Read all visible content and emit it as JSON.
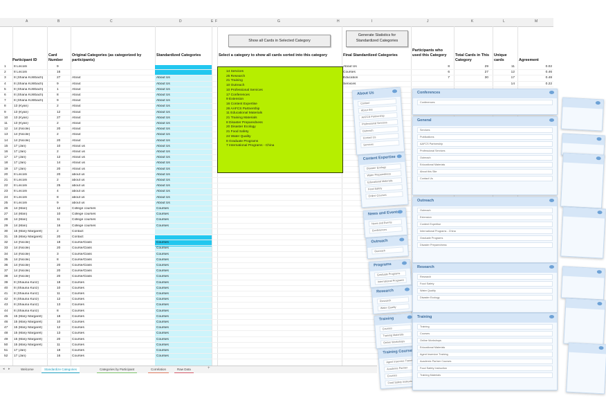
{
  "columns": [
    "A",
    "B",
    "C",
    "D",
    "E",
    "F",
    "G",
    "H",
    "I",
    "J",
    "K",
    "L",
    "M"
  ],
  "headers": {
    "participant": "Participant ID",
    "card_number": "Card Number",
    "original": "Original Categories (as categorized by participants)",
    "standardized": "Standardized Categories",
    "select_prompt": "Select a category to show all cards sorted into this category",
    "final": "Final Standardized Categories",
    "participants_used": "Participants who used this Category",
    "total_cards": "Total Cards in This Category",
    "unique_cards": "Unique cards",
    "agreement": "Agreement"
  },
  "buttons": {
    "show_all": "Show all Cards in Selected Category",
    "generate": "Generate Statistics for Standardized Categories"
  },
  "rows": [
    [
      "1",
      "8 Lincoln",
      "9",
      "",
      ""
    ],
    [
      "2",
      "8 Lincoln",
      "16",
      "",
      ""
    ],
    [
      "3",
      "8 (Shana Kohlbach)",
      "27",
      "About",
      "About Us"
    ],
    [
      "4",
      "8 (Shana Kohlbach)",
      "9",
      "About",
      "About Us"
    ],
    [
      "5",
      "8 (Shana Kohlbach)",
      "1",
      "About",
      "About Us"
    ],
    [
      "6",
      "8 (Shana Kohlbach)",
      "8",
      "About",
      "About Us"
    ],
    [
      "7",
      "8 (Shana Kohlbach)",
      "9",
      "About",
      "About Us"
    ],
    [
      "8",
      "13 (Kyan)",
      "2",
      "About",
      "About Us"
    ],
    [
      "9",
      "13 (Kyan)",
      "12",
      "About",
      "About Us"
    ],
    [
      "10",
      "13 (Kyan)",
      "27",
      "About",
      "About Us"
    ],
    [
      "11",
      "13 (Kyan)",
      "2",
      "About",
      "About Us"
    ],
    [
      "12",
      "14 (Nicole)",
      "20",
      "About",
      "About Us"
    ],
    [
      "13",
      "14 (Nicole)",
      "2",
      "About",
      "About Us"
    ],
    [
      "14",
      "14 (Nicole)",
      "20",
      "About",
      "About Us"
    ],
    [
      "15",
      "17 (Jan)",
      "10",
      "About us",
      "About Us"
    ],
    [
      "16",
      "17 (Jan)",
      "2",
      "About us",
      "About Us"
    ],
    [
      "17",
      "17 (Jan)",
      "12",
      "About us",
      "About Us"
    ],
    [
      "18",
      "17 (Jan)",
      "14",
      "About us",
      "About Us"
    ],
    [
      "19",
      "17 (Jan)",
      "20",
      "About us",
      "About Us"
    ],
    [
      "20",
      "8 Lincoln",
      "20",
      "about us",
      "About Us"
    ],
    [
      "21",
      "8 Lincoln",
      "2",
      "about us",
      "About Us"
    ],
    [
      "22",
      "8 Lincoln",
      "25",
      "about us",
      "About Us"
    ],
    [
      "23",
      "8 Lincoln",
      "4",
      "about us",
      "About Us"
    ],
    [
      "24",
      "8 Lincoln",
      "8",
      "about us",
      "About Us"
    ],
    [
      "25",
      "8 Lincoln",
      "9",
      "about us",
      "About Us"
    ],
    [
      "26",
      "14 (Mari)",
      "12",
      "College courses",
      "Courses"
    ],
    [
      "27",
      "14 (Mari)",
      "10",
      "College courses",
      "Courses"
    ],
    [
      "28",
      "14 (Mari)",
      "11",
      "College courses",
      "Courses"
    ],
    [
      "29",
      "14 (Mari)",
      "16",
      "College courses",
      "Courses"
    ],
    [
      "30",
      "15 (Mary Margaret)",
      "2",
      "Contact",
      ""
    ],
    [
      "31",
      "15 (Mary Margaret)",
      "20",
      "Contact",
      ""
    ],
    [
      "32",
      "14 (Nicole)",
      "18",
      "Course/Class",
      "Courses"
    ],
    [
      "33",
      "14 (Nicole)",
      "20",
      "Course/Class",
      "Courses"
    ],
    [
      "34",
      "14 (Nicole)",
      "3",
      "Course/Class",
      "Courses"
    ],
    [
      "35",
      "14 (Nicole)",
      "8",
      "Course/Class",
      "Courses"
    ],
    [
      "36",
      "14 (Nicole)",
      "20",
      "Course/Class",
      "Courses"
    ],
    [
      "37",
      "14 (Nicole)",
      "20",
      "Course/Class",
      "Courses"
    ],
    [
      "38",
      "14 (Nicole)",
      "20",
      "Course/Class",
      "Courses"
    ],
    [
      "39",
      "8 (Shauna Kunz)",
      "18",
      "Courses",
      "Courses"
    ],
    [
      "40",
      "8 (Shauna Kunz)",
      "10",
      "Courses",
      "Courses"
    ],
    [
      "41",
      "8 (Shauna Kunz)",
      "11",
      "Courses",
      "Courses"
    ],
    [
      "42",
      "8 (Shauna Kunz)",
      "12",
      "Courses",
      "Courses"
    ],
    [
      "43",
      "8 (Shauna Kunz)",
      "13",
      "Courses",
      "Courses"
    ],
    [
      "44",
      "8 (Shauna Kunz)",
      "8",
      "Courses",
      "Courses"
    ],
    [
      "45",
      "15 (Mary Margaret)",
      "18",
      "Courses",
      "Courses"
    ],
    [
      "46",
      "15 (Mary Margaret)",
      "10",
      "Courses",
      "Courses"
    ],
    [
      "47",
      "15 (Mary Margaret)",
      "12",
      "Courses",
      "Courses"
    ],
    [
      "48",
      "15 (Mary Margaret)",
      "13",
      "Courses",
      "Courses"
    ],
    [
      "49",
      "15 (Mary Margaret)",
      "20",
      "Courses",
      "Courses"
    ],
    [
      "50",
      "15 (Mary Margaret)",
      "11",
      "Courses",
      "Courses"
    ],
    [
      "51",
      "17 (Jan)",
      "18",
      "Courses",
      "Courses"
    ],
    [
      "52",
      "17 (Jan)",
      "16",
      "Courses",
      "Courses"
    ]
  ],
  "green_list": [
    "14 Services",
    "25 Research",
    "21 Training",
    "10 Outreach",
    "10 Professional Services",
    "17 Conferences",
    "9 Extension",
    "16 Content Expertise",
    "26 AAFCS Partnership",
    "11 Educational Materials",
    "21 Training Materials",
    "8 Disaster Preparedness",
    "20 Disaster Ecology",
    "21 Food Safety",
    "24 Water Quality",
    "8 Graduate Programs",
    "7 International Programs - China"
  ],
  "stats": [
    [
      "About Us",
      "8",
      "29",
      "11",
      "0.02"
    ],
    [
      "Courses",
      "6",
      "27",
      "12",
      "0.46"
    ],
    [
      "Education",
      "7",
      "30",
      "17",
      "0.48"
    ],
    [
      "Services",
      "",
      "",
      "14",
      "0.22"
    ]
  ],
  "tabs": [
    "Welcome",
    "Standardize Categories",
    "Categories by Participant",
    "Correlation",
    "Raw Data"
  ],
  "cards": {
    "conferences": {
      "title": "Conferences",
      "items": [
        "Conferences"
      ]
    },
    "general": {
      "title": "General",
      "items": [
        "Services",
        "Publications",
        "AAFCS Partnership",
        "Professional Services",
        "Outreach",
        "Educational Materials",
        "About this Site",
        "Contact Us"
      ]
    },
    "outreach": {
      "title": "Outreach",
      "items": [
        "Outreach",
        "Extension",
        "Content Expertise",
        "International Programs - China",
        "Graduate Programs",
        "Disaster Preparedness"
      ]
    },
    "research": {
      "title": "Research",
      "items": [
        "Research",
        "Food Safety",
        "Water Quality",
        "Disaster Ecology"
      ]
    },
    "training": {
      "title": "Training",
      "items": [
        "Training",
        "Courses",
        "Online Workshops",
        "Educational Materials",
        "Agent Inservice Training",
        "Academic Partner Courses",
        "Food Safety Instruction",
        "Training Materials"
      ]
    },
    "back1": {
      "title": "About Us",
      "items": [
        "Contact",
        "About this",
        "AAFCS Partnership",
        "Professional Services",
        "Outreach",
        "Contact Us",
        "Services"
      ]
    },
    "back2": {
      "title": "Content Expertise",
      "items": [
        "Disaster Ecology",
        "Water Preparedness",
        "Educational Materials",
        "Food Safety",
        "Online Courses"
      ]
    },
    "back3": {
      "title": "News and Events",
      "items": [
        "News and Events",
        "Conferences"
      ]
    },
    "back4": {
      "title": "Outreach",
      "items": [
        "Outreach"
      ]
    },
    "back5": {
      "title": "Programs",
      "items": [
        "Graduate Programs",
        "International Programs"
      ]
    },
    "back6": {
      "title": "Research",
      "items": [
        "Research",
        "Water Quality"
      ]
    },
    "back7": {
      "title": "Training",
      "items": [
        "Courses",
        "Training Materials",
        "Online Workshops"
      ]
    },
    "back8": {
      "title": "Training Courses",
      "items": [
        "Agent Inservice Training",
        "Academic Partner",
        "Courses",
        "Food Safety Instruction"
      ]
    }
  }
}
